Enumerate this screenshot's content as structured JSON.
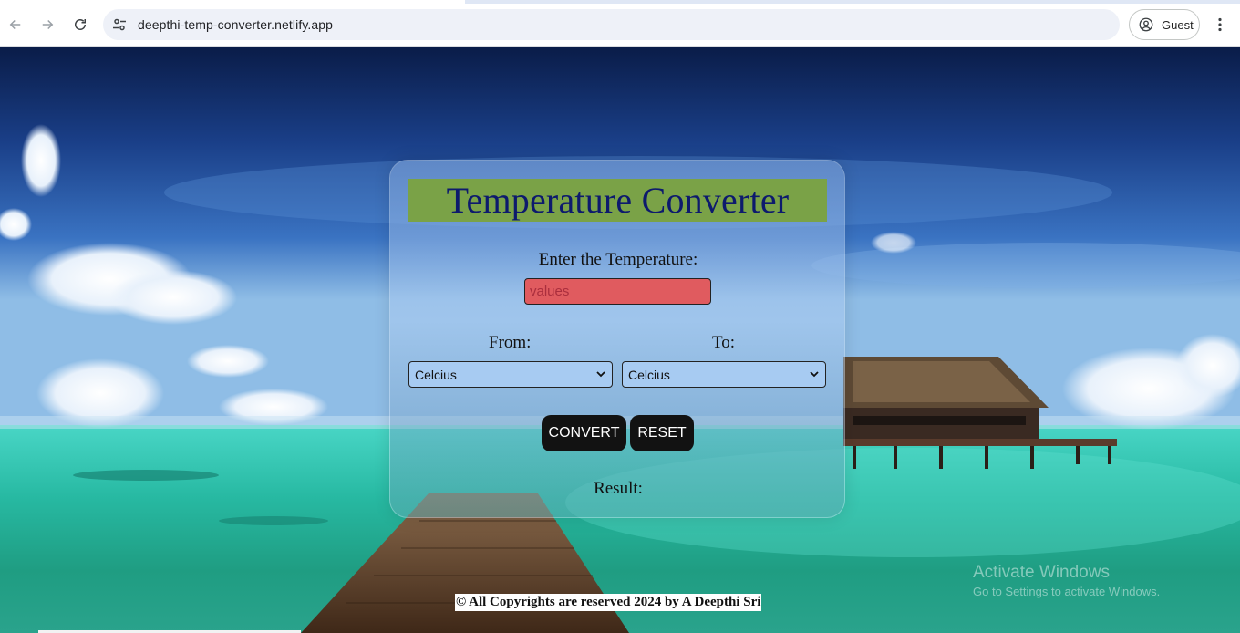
{
  "browser": {
    "url": "deepthi-temp-converter.netlify.app",
    "profile_label": "Guest",
    "icons": {
      "back": "arrow-left-icon",
      "forward": "arrow-right-icon",
      "reload": "reload-icon",
      "site_info": "tune-icon",
      "profile": "account-circle-icon",
      "menu": "more-vertical-icon"
    }
  },
  "converter": {
    "title": "Temperature Converter",
    "enter_label": "Enter the Temperature:",
    "input_placeholder": "values",
    "input_value": "",
    "from_label": "From:",
    "to_label": "To:",
    "from_selected": "Celcius",
    "to_selected": "Celcius",
    "convert_label": "CONVERT",
    "reset_label": "RESET",
    "result_label": "Result:"
  },
  "footer": {
    "text": "© All Copyrights are reserved 2024 by A Deepthi Sri"
  },
  "os_watermark": {
    "title": "Activate Windows",
    "subtitle": "Go to Settings to activate Windows."
  },
  "colors": {
    "title_band": "#7aa247",
    "title_text": "#0d1a6d",
    "input_bg": "#e05b5f",
    "select_bg": "#a7cbf2",
    "button_bg": "#121212"
  }
}
